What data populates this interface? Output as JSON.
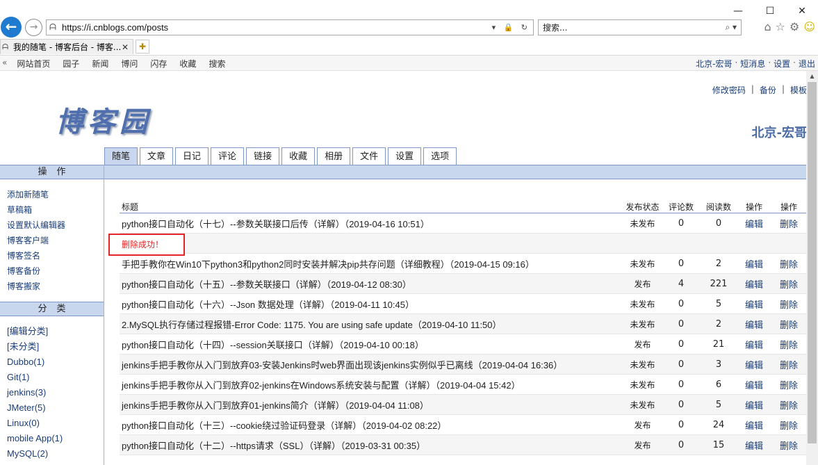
{
  "browser": {
    "url": "https://i.cnblogs.com/posts",
    "search_placeholder": "搜索...",
    "tab_title": "我的随笔 - 博客后台 - 博客...",
    "window_min": "—",
    "window_max": "☐",
    "window_close": "✕"
  },
  "site_nav": {
    "left": [
      "网站首页",
      "园子",
      "新闻",
      "博问",
      "闪存",
      "收藏",
      "搜索"
    ],
    "right": [
      "北京-宏哥",
      "短消息",
      "设置",
      "退出"
    ]
  },
  "header": {
    "links": [
      "修改密码",
      "备份",
      "模板"
    ],
    "logo_text": "博客园",
    "user_title": "北京-宏哥"
  },
  "main_tabs": [
    "随笔",
    "文章",
    "日记",
    "评论",
    "链接",
    "收藏",
    "相册",
    "文件",
    "设置",
    "选项"
  ],
  "sidebar": {
    "ops_title": "操作",
    "ops": [
      "添加新随笔",
      "草稿箱",
      "设置默认编辑器",
      "博客客户端",
      "博客签名",
      "博客备份",
      "博客搬家"
    ],
    "cat_title": "分类",
    "cats": [
      "[编辑分类]",
      "[未分类]",
      "Dubbo(1)",
      "Git(1)",
      "jenkins(3)",
      "JMeter(5)",
      "Linux(0)",
      "mobile App(1)",
      "MySQL(2)"
    ]
  },
  "table": {
    "headers": {
      "title": "标题",
      "status": "发布状态",
      "comments": "评论数",
      "reads": "阅读数",
      "op1": "操作",
      "op2": "操作"
    },
    "message": "删除成功！",
    "rows": [
      {
        "title": "python接口自动化（十七）--参数关联接口后传（详解）（2019-04-16 10:51）",
        "status": "未发布",
        "comments": "0",
        "reads": "0",
        "edit": "编辑",
        "del": "删除"
      },
      {
        "title": "手把手教你在Win10下python3和python2同时安装并解决pip共存问题（详细教程）（2019-04-15 09:16）",
        "status": "未发布",
        "comments": "0",
        "reads": "2",
        "edit": "编辑",
        "del": "删除"
      },
      {
        "title": "python接口自动化（十五）--参数关联接口（详解）（2019-04-12 08:30）",
        "status": "发布",
        "comments": "4",
        "reads": "221",
        "edit": "编辑",
        "del": "删除"
      },
      {
        "title": "python接口自动化（十六）--Json 数据处理（详解）（2019-04-11 10:45）",
        "status": "未发布",
        "comments": "0",
        "reads": "5",
        "edit": "编辑",
        "del": "删除"
      },
      {
        "title": "2.MySQL执行存储过程报错-Error Code: 1175. You are using safe update（2019-04-10 11:50）",
        "status": "未发布",
        "comments": "0",
        "reads": "2",
        "edit": "编辑",
        "del": "删除"
      },
      {
        "title": "python接口自动化（十四）--session关联接口（详解）（2019-04-10 00:18）",
        "status": "发布",
        "comments": "0",
        "reads": "21",
        "edit": "编辑",
        "del": "删除"
      },
      {
        "title": "jenkins手把手教你从入门到放弃03-安装Jenkins时web界面出现该jenkins实例似乎已离线（2019-04-04 16:36）",
        "status": "未发布",
        "comments": "0",
        "reads": "3",
        "edit": "编辑",
        "del": "删除"
      },
      {
        "title": "jenkins手把手教你从入门到放弃02-jenkins在Windows系统安装与配置（详解）（2019-04-04 15:42）",
        "status": "未发布",
        "comments": "0",
        "reads": "6",
        "edit": "编辑",
        "del": "删除"
      },
      {
        "title": "jenkins手把手教你从入门到放弃01-jenkins简介（详解）（2019-04-04 11:08）",
        "status": "未发布",
        "comments": "0",
        "reads": "5",
        "edit": "编辑",
        "del": "删除"
      },
      {
        "title": "python接口自动化（十三）--cookie绕过验证码登录（详解）（2019-04-02 08:22）",
        "status": "发布",
        "comments": "0",
        "reads": "24",
        "edit": "编辑",
        "del": "删除"
      },
      {
        "title": "python接口自动化（十二）--https请求（SSL）（详解）（2019-03-31 00:35）",
        "status": "发布",
        "comments": "0",
        "reads": "15",
        "edit": "编辑",
        "del": "删除"
      }
    ]
  }
}
